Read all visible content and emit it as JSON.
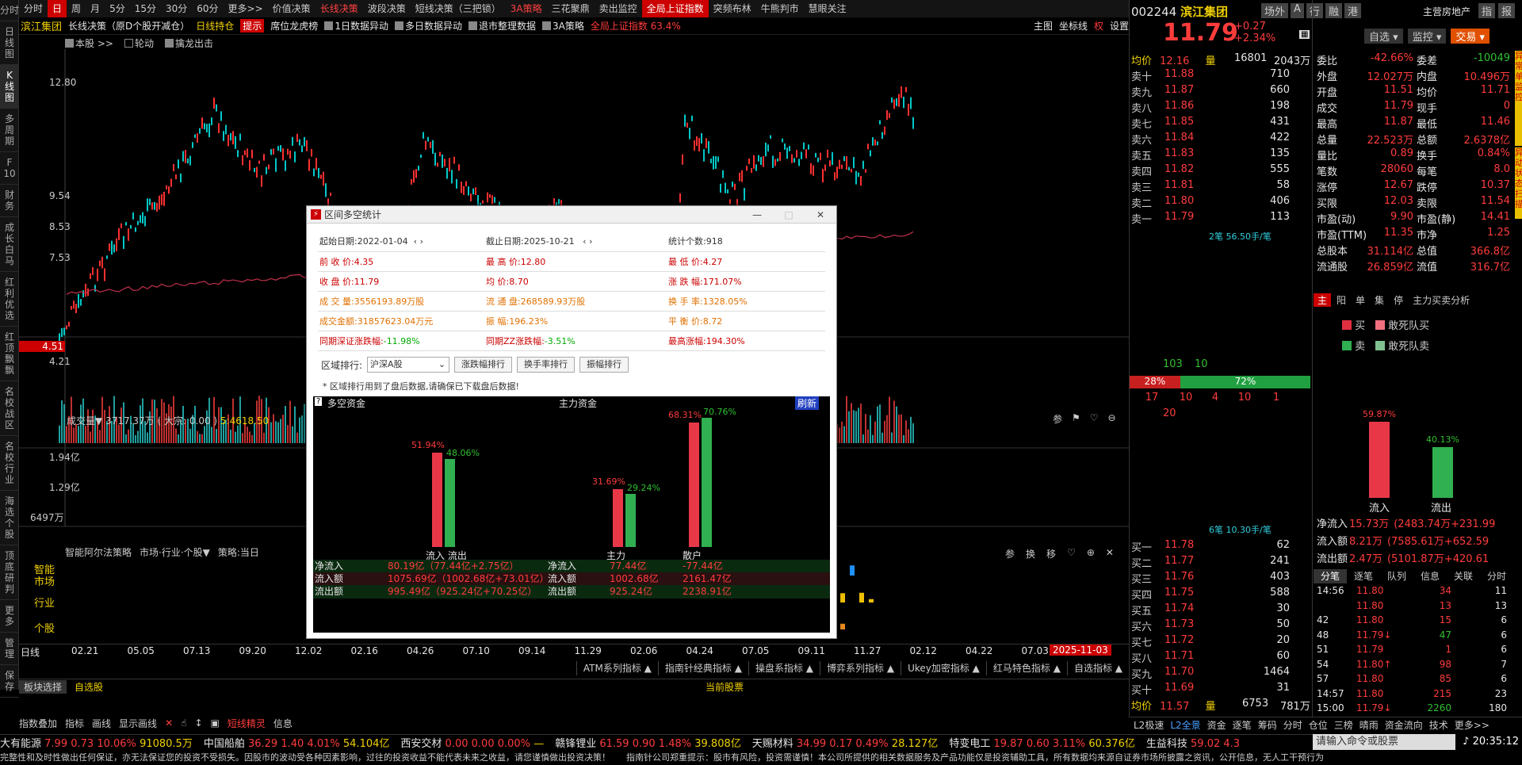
{
  "left_tabs": [
    "分时",
    "日\n线\n图",
    "K\n线\n图",
    "多\n周\n期",
    "F\n10",
    "财\n务",
    "成\n长\n白\n马",
    "红\n利\n优\n选",
    "红\n顶\n飘\n飘",
    "名\n校\n战\n区",
    "名\n校\n行\n业",
    "海\n选\n个\n股",
    "顶\n底\n研\n判",
    "更\n多",
    "管\n理",
    "保\n存"
  ],
  "top_menu": [
    "分时",
    "日",
    "周",
    "月",
    "5分",
    "15分",
    "30分",
    "60分",
    "更多>>",
    "价值决策",
    "长线决策",
    "波段决策",
    "短线决策（三把锁）",
    "3A策略",
    "三花聚鼎",
    "卖出监控",
    "全局上证指数",
    "突频布林",
    "牛熊判市",
    "慧眼关注"
  ],
  "title": {
    "name": "滨江集团",
    "strategy": "长线决策（原D个股开减仓）",
    "hold": "日线持仓",
    "tip": "提示",
    "dragon": "席位龙虎榜",
    "data1": "1日数据异动",
    "data_multi": "多日数据异动",
    "delist": "退市整理数据",
    "strat3a": "3A策略",
    "index_label": "全局上证指数 63.4%",
    "main": "主图",
    "coord": "坐标线",
    "rights": "权",
    "settings": "设置"
  },
  "chart_opts": {
    "main": "本股",
    "rotate": "轮动",
    "catch": "擒龙出击"
  },
  "y_labels": [
    "12.80",
    "9.54",
    "8.53",
    "7.53",
    "4.51",
    "4.21"
  ],
  "current_tag": "4.51",
  "volume": {
    "label": "成交量▼",
    "value": "3717.37万",
    "bigdeal": "( 大宗: 0.00 )",
    "ma5": "5:4618.50",
    "y": [
      "1.94亿",
      "1.29亿",
      "6497万"
    ]
  },
  "lower": {
    "title": "智能阿尔法策略",
    "filter": "市场·行业·个股▼",
    "strategy": "策略:当日",
    "rows": [
      "智能\n市场",
      "行业",
      "个股"
    ]
  },
  "x_labels": [
    "02.21",
    "05.05",
    "07.13",
    "09.20",
    "12.02",
    "02.16",
    "04.26",
    "07.10",
    "09.14",
    "11.29",
    "02.06",
    "04.24",
    "07.05",
    "09.11",
    "11.27",
    "02.12",
    "04.22",
    "07.03"
  ],
  "date_tag": "2025-11-03",
  "day_line": "日线",
  "indicator_bar": [
    "ATM系列指标 ▲",
    "指南针经典指标 ▲",
    "操盘系指标 ▲",
    "博弈系列指标 ▲",
    "Ukey加密指标 ▲",
    "红马特色指标 ▲",
    "自选指标 ▲"
  ],
  "board": {
    "select": "板块选择",
    "fav": "自选股",
    "current": "当前股票"
  },
  "toolbar2": [
    "指数叠加",
    "指标",
    "画线",
    "显示画线",
    "短线精灵",
    "信息"
  ],
  "dialog": {
    "title": "区间多空统计",
    "start_label": "起始日期:",
    "start": "2022-01-04",
    "end_label": "截止日期:",
    "end": "2025-10-21",
    "count_label": "统计个数:",
    "count": "918",
    "rows": [
      [
        "前 收 价:",
        "4.35",
        "最 高 价:",
        "12.80",
        "最 低 价:",
        "4.27"
      ],
      [
        "收 盘 价:",
        "11.79",
        "均    价:",
        "8.70",
        "涨 跌 幅:",
        "171.07%"
      ],
      [
        "成 交 量:",
        "3556193.89万股",
        "流 通 盘:",
        "268589.93万股",
        "换 手 率:",
        "1328.05%"
      ],
      [
        "成交金额:",
        "31857623.04万元",
        "振    幅:",
        "196.23%",
        "平 衡 价:",
        "8.72"
      ],
      [
        "同期深证涨跌幅:",
        "-11.98%",
        "同期ZZ涨跌幅:",
        "-3.51%",
        "最高涨幅:",
        "194.30%"
      ]
    ],
    "rank_label": "区域排行:",
    "rank_select": "沪深A股",
    "rank_buttons": [
      "涨跌幅排行",
      "换手率排行",
      "振幅排行"
    ],
    "note": "* 区域排行用到了盘后数据,请确保已下载盘后数据!",
    "money_title": "多空资金",
    "money_main": "主力资金",
    "refresh": "刷新",
    "groups": [
      {
        "label": "流入 流出",
        "in_pct": "51.94%",
        "out_pct": "48.06%",
        "in": 51.94,
        "out": 48.06
      },
      {
        "label": "主力",
        "in_pct": "31.69%",
        "out_pct": "29.24%",
        "in": 31.69,
        "out": 29.24
      },
      {
        "label": "散户",
        "in_pct": "68.31%",
        "out_pct": "70.76%",
        "in": 68.31,
        "out": 70.76
      }
    ],
    "table": [
      [
        "净流入",
        "80.19亿（77.44亿+2.75亿）",
        "净流入",
        "77.44亿",
        "-77.44亿"
      ],
      [
        "流入额",
        "1075.69亿（1002.68亿+73.01亿）",
        "流入额",
        "1002.68亿",
        "2161.47亿"
      ],
      [
        "流出额",
        "995.49亿（925.24亿+70.25亿）",
        "流出额",
        "925.24亿",
        "2238.91亿"
      ]
    ]
  },
  "quote": {
    "code": "002244",
    "name": "滨江集团",
    "tabs": [
      "场外",
      "A",
      "融",
      "港"
    ],
    "hk": "行",
    "industry": "主营房地产",
    "tab_zhi": "指",
    "tab_bao": "报",
    "price": "11.79",
    "chg": "+0.27",
    "pct": "+2.34%",
    "zx": "自选",
    "jk": "监控",
    "trade": "交易",
    "avg_label": "均价",
    "avg": "12.16",
    "vol_label": "量",
    "vol": "16801",
    "vol2": "2043万",
    "asks": [
      [
        "卖十",
        "11.88",
        "710"
      ],
      [
        "卖九",
        "11.87",
        "660"
      ],
      [
        "卖八",
        "11.86",
        "198"
      ],
      [
        "卖七",
        "11.85",
        "431"
      ],
      [
        "卖六",
        "11.84",
        "422"
      ],
      [
        "卖五",
        "11.83",
        "135"
      ],
      [
        "卖四",
        "11.82",
        "555"
      ],
      [
        "卖三",
        "11.81",
        "58"
      ],
      [
        "卖二",
        "11.80",
        "406"
      ],
      [
        "卖一",
        "11.79",
        "113"
      ]
    ],
    "ask_note": "2笔 56.50手/笔",
    "stats": [
      [
        "委比",
        "-42.66%",
        "委差",
        "-10049"
      ],
      [
        "外盘",
        "12.027万",
        "内盘",
        "10.496万"
      ],
      [
        "开盘",
        "11.51",
        "均价",
        "11.71"
      ],
      [
        "成交",
        "11.79",
        "现手",
        "0"
      ],
      [
        "最高",
        "11.87",
        "最低",
        "11.46"
      ],
      [
        "总量",
        "22.523万",
        "总额",
        "2.6378亿"
      ],
      [
        "量比",
        "0.89",
        "换手",
        "0.84%"
      ],
      [
        "笔数",
        "28060",
        "每笔",
        "8.0"
      ],
      [
        "涨停",
        "12.67",
        "跌停",
        "10.37"
      ],
      [
        "买限",
        "12.03",
        "卖限",
        "11.54"
      ],
      [
        "市盈(动)",
        "9.90",
        "市盈(静)",
        "14.41"
      ],
      [
        "市盈(TTM)",
        "11.35",
        "市净",
        "1.25"
      ],
      [
        "总股本",
        "31.114亿",
        "总值",
        "366.8亿"
      ],
      [
        "流通股",
        "26.859亿",
        "流值",
        "316.7亿"
      ]
    ],
    "ratio_left": "28%",
    "ratio_right": "72%",
    "r1": "103",
    "r2": "10",
    "r3": [
      "17",
      "10",
      "4",
      "10",
      "1"
    ],
    "r4": "20",
    "tabs2": [
      "主",
      "阳",
      "单",
      "集",
      "停",
      "主力买卖分析"
    ],
    "legend": [
      "买",
      "敢死队买",
      "卖",
      "敢死队卖"
    ],
    "flow_in_pct": "59.87%",
    "flow_out_pct": "40.13%",
    "flow_in": 59.87,
    "flow_out": 40.13,
    "flow_in_label": "流入",
    "flow_out_label": "流出",
    "flows": [
      [
        "净流入",
        "15.73万",
        "(2483.74万+231.99"
      ],
      [
        "流入额",
        "8.21万",
        "(7585.61万+652.59"
      ],
      [
        "流出额",
        "2.47万",
        "(5101.87万+420.61"
      ]
    ],
    "bid_note": "6笔 10.30手/笔",
    "bids": [
      [
        "买一",
        "11.78",
        "62"
      ],
      [
        "买二",
        "11.77",
        "241"
      ],
      [
        "买三",
        "11.76",
        "403"
      ],
      [
        "买四",
        "11.75",
        "588"
      ],
      [
        "买五",
        "11.74",
        "30"
      ],
      [
        "买六",
        "11.73",
        "50"
      ],
      [
        "买七",
        "11.72",
        "20"
      ],
      [
        "买八",
        "11.71",
        "60"
      ],
      [
        "买九",
        "11.70",
        "1464"
      ],
      [
        "买十",
        "11.69",
        "31"
      ]
    ],
    "bid_avg": "11.57",
    "bid_vol": "6753",
    "bid_vol2": "781万",
    "tick_tabs": [
      "分笔",
      "逐笔",
      "队列",
      "信息",
      "关联",
      "分时"
    ],
    "ticks": [
      [
        "14:56",
        "11.80",
        "34",
        "11"
      ],
      [
        "",
        "11.80",
        "13",
        "13"
      ],
      [
        "42",
        "11.80",
        "15",
        "6"
      ],
      [
        "48",
        "11.79↓",
        "47",
        "6"
      ],
      [
        "51",
        "11.79",
        "1",
        "6"
      ],
      [
        "54",
        "11.80↑",
        "98",
        "7"
      ],
      [
        "57",
        "11.80",
        "85",
        "6"
      ],
      [
        "14:57",
        "11.80",
        "215",
        "23"
      ],
      [
        "15:00",
        "11.79↓",
        "2260",
        "180"
      ]
    ],
    "bottom_tabs": [
      "L2极速",
      "L2全景",
      "资金",
      "逐笔",
      "筹码",
      "分时",
      "仓位",
      "三榜",
      "晴雨",
      "资金流向",
      "技术",
      "更多>>"
    ]
  },
  "ticker": [
    [
      "大有能源",
      "7.99",
      "0.73",
      "10.06%",
      "91080.5万"
    ],
    [
      "中国船舶",
      "36.29",
      "1.40",
      "4.01%",
      "54.104亿"
    ],
    [
      "西安交材",
      "0.00",
      "0.00",
      "0.00%",
      "—"
    ],
    [
      "赣锋锂业",
      "61.59",
      "0.90",
      "1.48%",
      "39.808亿"
    ],
    [
      "天赐材料",
      "34.99",
      "0.17",
      "0.49%",
      "28.127亿"
    ],
    [
      "特变电工",
      "19.87",
      "0.60",
      "3.11%",
      "60.376亿"
    ],
    [
      "生益科技",
      "59.02",
      "4.3",
      ""
    ]
  ],
  "cmd": "请输入命令或股票",
  "time": "20:35:12",
  "disclaimer": "完整性和及时性做出任何保证，亦无法保证您的投资不受损失。因股市的波动受各种因素影响，过往的投资收益不能代表未来之收益，请您谨慎做出投资决策！",
  "disclaimer2": "指南针公司郑重提示：股市有风险，投资需谨慎！本公司所提供的相关数据服务及产品功能仅是投资辅助工具，所有数据均来源自证券市场所披露之资讯，公开信息，无人工干预行为"
}
